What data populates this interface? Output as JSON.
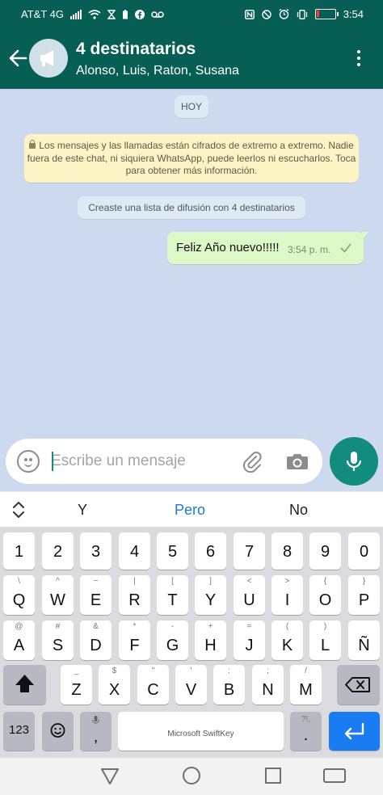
{
  "status_bar": {
    "carrier": "AT&T 4G",
    "time": "3:54",
    "battery_level": 0.15
  },
  "header": {
    "title": "4 destinatarios",
    "subtitle": "Alonso, Luis, Raton, Susana",
    "back_icon": "arrow-left-icon",
    "avatar_icon": "broadcast-megaphone-icon",
    "menu_icon": "more-vert-icon"
  },
  "chat": {
    "date_label": "HOY",
    "encryption_notice": "Los mensajes y las llamadas están cifrados de extremo a extremo. Nadie fuera de este chat, ni siquiera WhatsApp, puede leerlos ni escucharlos. Toca para obtener más información.",
    "system_message": "Creaste una lista de difusión con 4 destinatarios",
    "messages": [
      {
        "text": "Feliz Año nuevo!!!!!",
        "time": "3:54 p. m.",
        "status_icon": "check-icon"
      }
    ]
  },
  "composer": {
    "placeholder": "Escribe un mensaje",
    "value": "",
    "emoji_icon": "emoji-icon",
    "attach_icon": "paperclip-icon",
    "camera_icon": "camera-icon",
    "mic_icon": "mic-icon"
  },
  "keyboard": {
    "suggestions": [
      "Y",
      "Pero",
      "No"
    ],
    "number_row": [
      "1",
      "2",
      "3",
      "4",
      "5",
      "6",
      "7",
      "8",
      "9",
      "0"
    ],
    "row1": [
      {
        "key": "Q",
        "hint": "\\"
      },
      {
        "key": "W",
        "hint": "^"
      },
      {
        "key": "E",
        "hint": "~"
      },
      {
        "key": "R",
        "hint": "|"
      },
      {
        "key": "T",
        "hint": "["
      },
      {
        "key": "Y",
        "hint": "]"
      },
      {
        "key": "U",
        "hint": "<"
      },
      {
        "key": "I",
        "hint": ">"
      },
      {
        "key": "O",
        "hint": "{"
      },
      {
        "key": "P",
        "hint": "}"
      }
    ],
    "row2": [
      {
        "key": "A",
        "hint": "@"
      },
      {
        "key": "S",
        "hint": "#"
      },
      {
        "key": "D",
        "hint": "&"
      },
      {
        "key": "F",
        "hint": "*"
      },
      {
        "key": "G",
        "hint": "-"
      },
      {
        "key": "H",
        "hint": "+"
      },
      {
        "key": "J",
        "hint": "="
      },
      {
        "key": "K",
        "hint": "("
      },
      {
        "key": "L",
        "hint": ")"
      },
      {
        "key": "Ñ",
        "hint": ""
      }
    ],
    "row3": [
      {
        "key": "Z",
        "hint": "_"
      },
      {
        "key": "X",
        "hint": "$"
      },
      {
        "key": "C",
        "hint": "\""
      },
      {
        "key": "V",
        "hint": "'"
      },
      {
        "key": "B",
        "hint": ":"
      },
      {
        "key": "N",
        "hint": ";"
      },
      {
        "key": "M",
        "hint": "/"
      }
    ],
    "numbers_key": "123",
    "comma_key": ",",
    "period_key": ".",
    "period_hint": "?!,",
    "space_label": "Microsoft SwiftKey",
    "accent_color": "#1a7cf3"
  },
  "colors": {
    "whatsapp_header": "#075e54",
    "whatsapp_accent": "#128c7e",
    "chat_background": "#cdd9ee",
    "outgoing_bubble": "#dcf8c6"
  }
}
